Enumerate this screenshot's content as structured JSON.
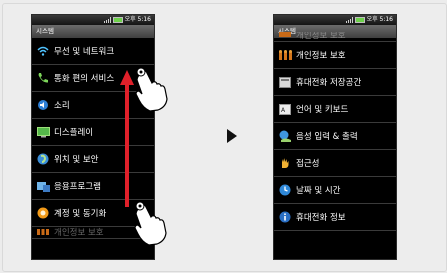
{
  "left_phone": {
    "status": {
      "time": "오후 5:16"
    },
    "title": "시스템",
    "items": [
      {
        "label": "무선 및 네트워크",
        "icon": "wifi-icon"
      },
      {
        "label": "통화 편의 서비스",
        "icon": "phone-icon"
      },
      {
        "label": "소리",
        "icon": "sound-icon"
      },
      {
        "label": "디스플레이",
        "icon": "display-icon"
      },
      {
        "label": "위치 및 보안",
        "icon": "location-icon"
      },
      {
        "label": "응용프로그램",
        "icon": "apps-icon"
      },
      {
        "label": "계정 및 동기화",
        "icon": "sync-icon"
      },
      {
        "label": "개인정보 보호",
        "icon": "privacy-icon"
      }
    ]
  },
  "right_phone": {
    "status": {
      "time": "오후 5:16"
    },
    "title": "시스템",
    "items": [
      {
        "label": "개인정보 보호",
        "icon": "privacy-icon"
      },
      {
        "label": "개인정보 보호",
        "icon": "privacy-icon"
      },
      {
        "label": "휴대전화 저장공간",
        "icon": "storage-icon"
      },
      {
        "label": "언어 및 키보드",
        "icon": "keyboard-icon"
      },
      {
        "label": "음성 입력 & 출력",
        "icon": "voice-icon"
      },
      {
        "label": "접근성",
        "icon": "accessibility-icon"
      },
      {
        "label": "날짜 및 시간",
        "icon": "clock-icon"
      },
      {
        "label": "휴대전화 정보",
        "icon": "info-icon"
      }
    ]
  },
  "gesture": {
    "description_icon": "swipe-up-hand-icon",
    "arrow_color": "#e0202a"
  }
}
